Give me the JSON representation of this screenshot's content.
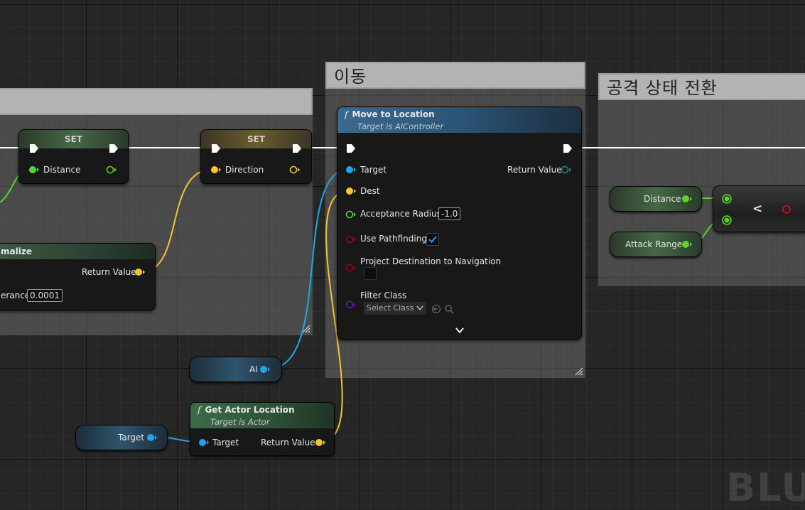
{
  "comments": {
    "left_comment_title": "",
    "move_comment_title": "이동",
    "attack_comment_title": "공격 상태 전환"
  },
  "set_distance": {
    "header": "SET",
    "pin_label": "Distance"
  },
  "set_direction": {
    "header": "SET",
    "pin_label": "Direction"
  },
  "normalize": {
    "title_partial": "malize",
    "return_label": "Return Value",
    "tolerance_partial": "erance",
    "tolerance_value": "0.0001"
  },
  "move_to_location": {
    "title": "Move to Location",
    "subtitle": "Target is AIController",
    "target_label": "Target",
    "return_label": "Return Value",
    "dest_label": "Dest",
    "acceptance_label": "Acceptance Radius",
    "acceptance_value": "-1.0",
    "use_pathfinding_label": "Use Pathfinding",
    "use_pathfinding_checked": true,
    "project_label": "Project Destination to Navigation",
    "project_checked": false,
    "filter_label": "Filter Class",
    "filter_value": "Select Class"
  },
  "get_actor_location": {
    "title": "Get Actor Location",
    "subtitle": "Target is Actor",
    "target_label": "Target",
    "return_label": "Return Value"
  },
  "var_ai": {
    "label": "AI"
  },
  "var_target": {
    "label": "Target"
  },
  "var_distance": {
    "label": "Distance"
  },
  "var_attack_range": {
    "label": "Attack Range"
  },
  "compare_node": {
    "operator": "<"
  },
  "watermark": "BLUE",
  "colors": {
    "exec": "#ffffff",
    "float_pin": "#57d52b",
    "vector_pin": "#f6c42d",
    "object_pin": "#1fa7e8",
    "bool_pin": "#8c0b0b",
    "class_pin": "#6b16b5"
  }
}
